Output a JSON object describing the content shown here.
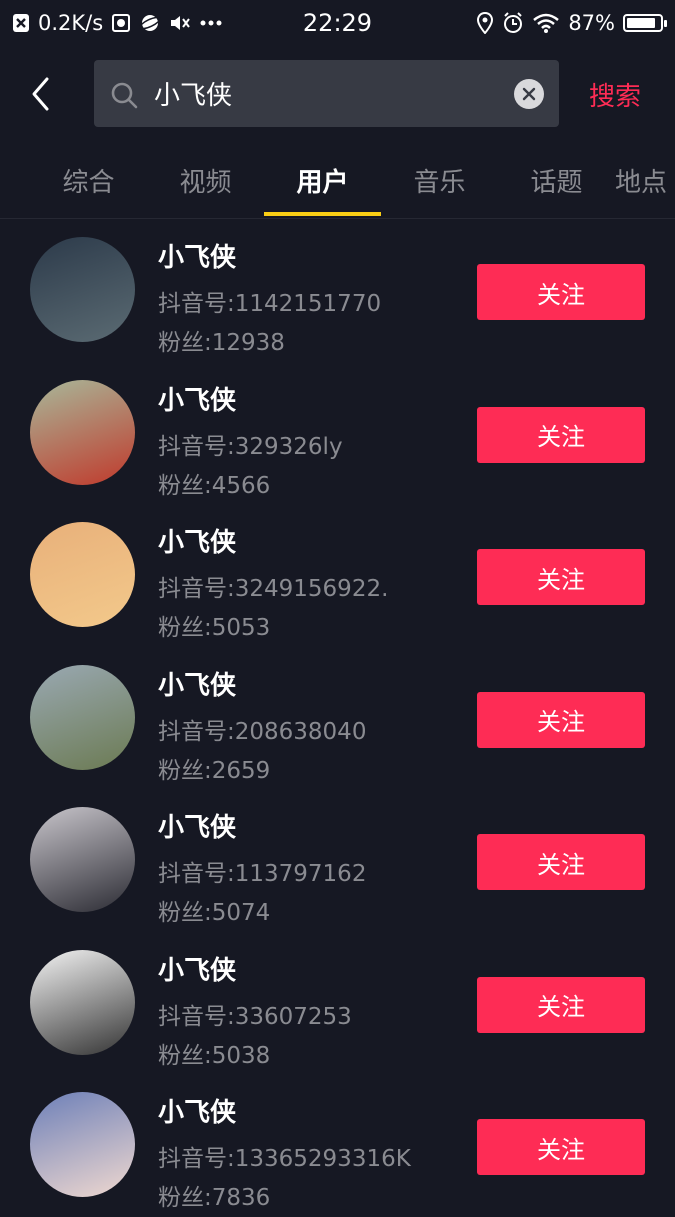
{
  "status_bar": {
    "speed": "0.2K/s",
    "time": "22:29",
    "battery": "87%",
    "battery_level": 0.87,
    "icons": [
      "close-box-icon",
      "screenshot-icon",
      "planet-icon",
      "mute-icon",
      "more-dots-icon",
      "location-icon",
      "alarm-icon",
      "wifi-icon",
      "battery-icon"
    ]
  },
  "search": {
    "query": "小飞侠",
    "button_label": "搜索"
  },
  "tabs": [
    {
      "label": "综合"
    },
    {
      "label": "视频"
    },
    {
      "label": "用户"
    },
    {
      "label": "音乐"
    },
    {
      "label": "话题"
    },
    {
      "label": "地点"
    }
  ],
  "active_tab": "用户",
  "users": [
    {
      "name": "小飞侠",
      "id_text": "抖音号:1142151770",
      "fans_text": "粉丝:12938",
      "follow_label": "关注",
      "avatar_colors": [
        "#2c3a4a",
        "#5b6b73"
      ]
    },
    {
      "name": "小飞侠",
      "id_text": "抖音号:329326ly",
      "fans_text": "粉丝:4566",
      "follow_label": "关注",
      "avatar_colors": [
        "#a8b89a",
        "#c0392b"
      ]
    },
    {
      "name": "小飞侠",
      "id_text": "抖音号:3249156922.",
      "fans_text": "粉丝:5053",
      "follow_label": "关注",
      "avatar_colors": [
        "#e8b07a",
        "#f3c98b"
      ]
    },
    {
      "name": "小飞侠",
      "id_text": "抖音号:208638040",
      "fans_text": "粉丝:2659",
      "follow_label": "关注",
      "avatar_colors": [
        "#9aa9b3",
        "#6b7a52"
      ]
    },
    {
      "name": "小飞侠",
      "id_text": "抖音号:113797162",
      "fans_text": "粉丝:5074",
      "follow_label": "关注",
      "avatar_colors": [
        "#c9c6cc",
        "#2b2b33"
      ]
    },
    {
      "name": "小飞侠",
      "id_text": "抖音号:33607253",
      "fans_text": "粉丝:5038",
      "follow_label": "关注",
      "avatar_colors": [
        "#f4f4f4",
        "#333333"
      ]
    },
    {
      "name": "小飞侠",
      "id_text": "抖音号:13365293316K",
      "fans_text": "粉丝:7836",
      "follow_label": "关注",
      "avatar_colors": [
        "#6c7fb8",
        "#f0d9d0"
      ]
    }
  ],
  "colors": {
    "background": "#161823",
    "accent": "#fe2c55",
    "tab_indicator": "#face15",
    "secondary_text": "#8a8b91",
    "search_box": "#373a44"
  }
}
